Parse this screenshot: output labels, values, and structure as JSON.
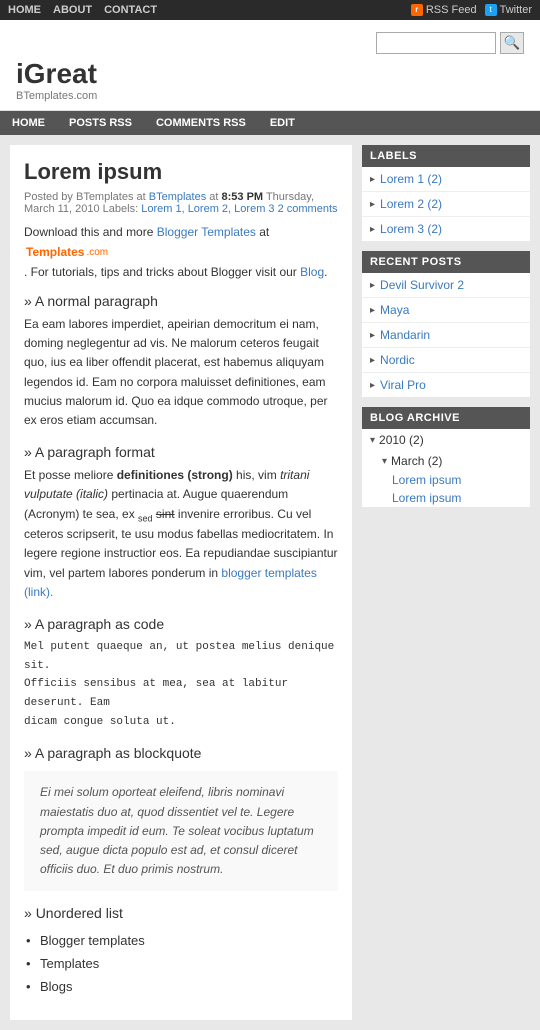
{
  "topbar": {
    "nav": [
      {
        "label": "HOME",
        "href": "#"
      },
      {
        "label": "ABOUT",
        "href": "#"
      },
      {
        "label": "CONTACT",
        "href": "#"
      }
    ],
    "rss_label": "RSS Feed",
    "twitter_label": "Twitter"
  },
  "header": {
    "site_title": "iGreat",
    "tagline": "BTemplates.com",
    "search_placeholder": "",
    "search_button_label": "🔍"
  },
  "mainnav": [
    {
      "label": "HOME"
    },
    {
      "label": "POSTS RSS"
    },
    {
      "label": "COMMENTS RSS"
    },
    {
      "label": "EDIT"
    }
  ],
  "post": {
    "title": "Lorem ipsum",
    "meta_posted_by": "Posted by BTemplates at ",
    "meta_time": "8:53 PM",
    "meta_date": " Thursday, March 11, 2010 Labels: ",
    "labels": [
      {
        "text": "Lorem 1",
        "href": "#"
      },
      {
        "text": "Lorem 2",
        "href": "#"
      },
      {
        "text": "Lorem 3",
        "href": "#"
      }
    ],
    "comments": "2 comments",
    "download_line": "Download this and more ",
    "blogger_templates_link": "Blogger Templates",
    "at_text": " at",
    "for_tutorials": ". For tutorials, tips and tricks about Blogger visit our ",
    "blog_link": "Blog",
    "sections": [
      {
        "type": "heading",
        "text": "A normal paragraph"
      },
      {
        "type": "paragraph",
        "text": "Ea eam labores imperdiet, apeirian democritum ei nam, doming neglegentur ad vis. Ne malorum ceteros feugait quo, ius ea liber offendit placerat, est habemus aliquyam legendos id. Eam no corpora maluisset definitiones, eam mucius malorum id. Quo ea idque commodo utroque, per ex eros etiam accumsan."
      },
      {
        "type": "heading",
        "text": "A paragraph format"
      },
      {
        "type": "format_para",
        "text_before": "Et posse meliore ",
        "strong": "definitiones (strong)",
        "text_mid1": " his, vim ",
        "italic": "tritani vulputate (italic)",
        "text_mid2": " pertinacia at. Augue quaerendum (Acronym) te sea, ex ",
        "sub_text": "sed",
        "text_mid3": " sint ",
        "sup_text": "sint",
        "text_end": " invenire erroribus. Cu vel ceteros scripserit, te usu modus fabellas mediocritatem. In legere regione instructior eos. Ea repudiandae suscipiantur vim, vel partem labores ponderum in ",
        "link_text": "blogger templates (link).",
        "link_href": "#"
      },
      {
        "type": "heading",
        "text": "A paragraph as code"
      },
      {
        "type": "code",
        "text": "Mel putent quaeque an, ut postea melius denique sit.\nOfficiis sensibus at mea, sea at labitur deserunt. Eam\ndicam congue soluta ut."
      },
      {
        "type": "heading",
        "text": "A paragraph as blockquote"
      },
      {
        "type": "blockquote",
        "text": "Ei mei solum oporteat eleifend, libris nominavi\nmaiestatis duo at, quod dissentiet vel te. Legere\nprompta impedit id eum. Te soleat vocibus luptatum\nsed, augue dicta populo est ad, et consul diceret officiis\nduo. Et duo primis nostrum."
      },
      {
        "type": "heading",
        "text": "Unordered list"
      },
      {
        "type": "list",
        "items": [
          "Blogger templates",
          "Templates",
          "Blogs"
        ]
      }
    ]
  },
  "sidebar": {
    "labels_title": "LABELS",
    "labels": [
      {
        "text": "Lorem 1 (2)"
      },
      {
        "text": "Lorem 2 (2)"
      },
      {
        "text": "Lorem 3 (2)"
      }
    ],
    "recent_title": "RECENT POSTS",
    "recent": [
      {
        "text": "Devil Survivor 2"
      },
      {
        "text": "Maya"
      },
      {
        "text": "Mandarin"
      },
      {
        "text": "Nordic"
      },
      {
        "text": "Viral Pro"
      }
    ],
    "archive_title": "BLOG ARCHIVE",
    "archive_year": "2010 (2)",
    "archive_month": "March (2)",
    "archive_posts": [
      "Lorem ipsum",
      "Lorem ipsum"
    ]
  }
}
